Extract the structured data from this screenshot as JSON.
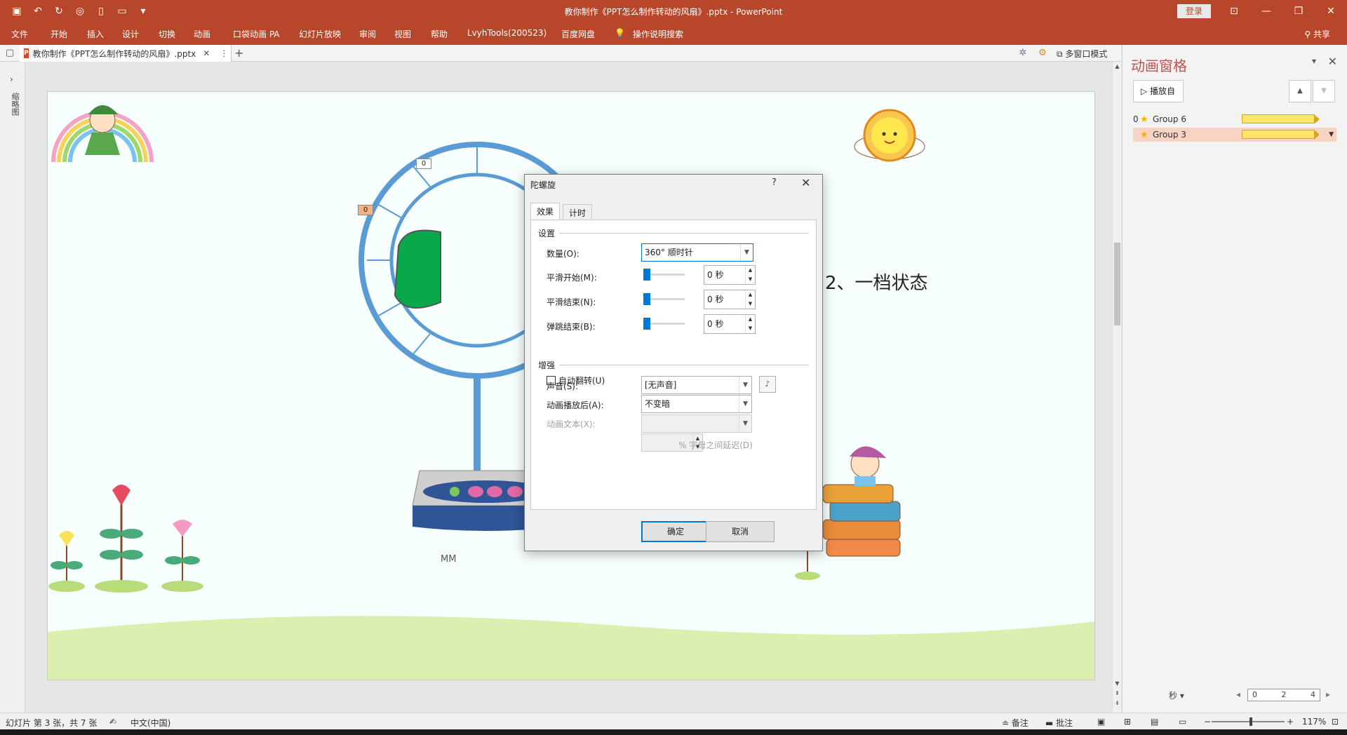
{
  "window": {
    "title": "教你制作《PPT怎么制作转动的风扇》.pptx  -  PowerPoint",
    "login_label": "登录",
    "controls": [
      "⊡",
      "—",
      "❐",
      "✕"
    ]
  },
  "qat": [
    "save-icon",
    "undo-icon",
    "redo-icon",
    "present-icon",
    "new-icon",
    "open-icon",
    "customize-icon"
  ],
  "ribbon": {
    "tabs": [
      "文件",
      "开始",
      "插入",
      "设计",
      "切换",
      "动画",
      "口袋动画 PA",
      "幻灯片放映",
      "审阅",
      "视图",
      "帮助",
      "LvyhTools(200523)",
      "百度网盘",
      "操作说明搜索"
    ],
    "share_label": "共享"
  },
  "doc_tab": {
    "name": "教你制作《PPT怎么制作转动的风扇》.pptx",
    "multi_window_label": "多窗口模式"
  },
  "thumbnail_rail": {
    "label": "缩略图"
  },
  "slide": {
    "text": "2、一档状态",
    "tags": [
      "0",
      "0"
    ],
    "base_mark": "MM"
  },
  "anim_pane": {
    "title": "动画窗格",
    "play_label": "播放自",
    "items": [
      {
        "index": "0",
        "name": "Group 6",
        "selected": false
      },
      {
        "index": "",
        "name": "Group 3",
        "selected": true
      }
    ],
    "timeline": {
      "unit": "秒",
      "ticks": [
        "0",
        "2",
        "4"
      ]
    }
  },
  "dialog": {
    "title": "陀螺旋",
    "tabs": [
      "效果",
      "计时"
    ],
    "active_tab": "效果",
    "settings_header": "设置",
    "amount_label": "数量(O):",
    "amount_value": "360° 顺时针",
    "smooth_start_label": "平滑开始(M):",
    "smooth_start_value": "0 秒",
    "smooth_end_label": "平滑结束(N):",
    "smooth_end_value": "0 秒",
    "bounce_end_label": "弹跳结束(B):",
    "bounce_end_value": "0 秒",
    "auto_reverse_label": "自动翻转(U)",
    "auto_reverse_checked": false,
    "enhance_header": "增强",
    "sound_label": "声音(S):",
    "sound_value": "[无声音]",
    "after_label": "动画播放后(A):",
    "after_value": "不变暗",
    "anim_text_label": "动画文本(X):",
    "anim_text_value": "",
    "char_delay_label": "% 字母之间延迟(D)",
    "char_delay_value": "",
    "ok_label": "确定",
    "cancel_label": "取消"
  },
  "status": {
    "slide_info": "幻灯片 第 3 张，共 7 张",
    "language": "中文(中国)",
    "notes_label": "备注",
    "comments_label": "批注",
    "zoom": "117%"
  },
  "colors": {
    "accent": "#b7472a",
    "pane_title": "#c0504d",
    "selection": "#f8d3c1",
    "focus": "#0078d7"
  }
}
